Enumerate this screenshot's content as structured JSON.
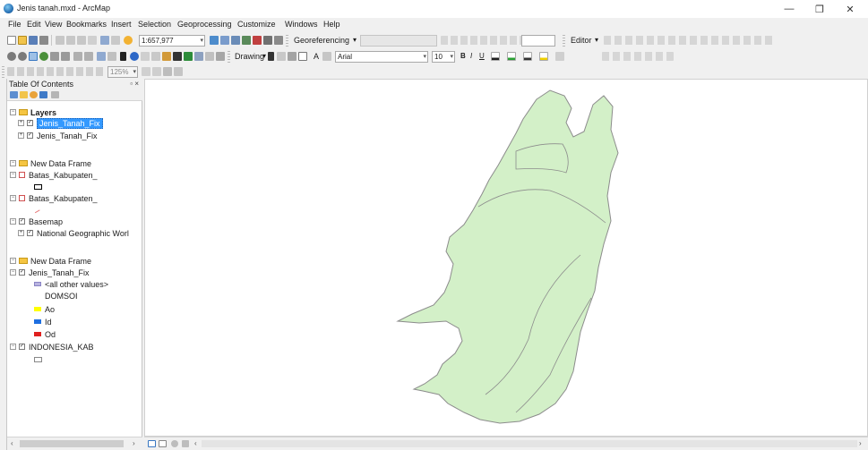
{
  "window": {
    "title": "Jenis tanah.mxd - ArcMap",
    "minimize_glyph": "—",
    "restore_glyph": "❐",
    "close_glyph": "✕"
  },
  "menu": [
    "File",
    "Edit",
    "View",
    "Bookmarks",
    "Insert",
    "Selection",
    "Geoprocessing",
    "Customize",
    "Windows",
    "Help"
  ],
  "toolbar": {
    "scale_value": "1:657,977",
    "georeferencing_label": "Georeferencing",
    "editor_label": "Editor",
    "drawing_label": "Drawing",
    "font_value": "Arial",
    "font_size_value": "10",
    "bold": "B",
    "italic": "I",
    "underline": "U",
    "text_tool": "A",
    "zoom_value": "125%"
  },
  "toc": {
    "header": "Table Of Contents",
    "pin_glyph": "▫ ×",
    "rows": [
      {
        "label": "Layers",
        "bold": true
      },
      {
        "label": "Jenis_Tanah_Fix",
        "selected": true
      },
      {
        "label": "Jenis_Tanah_Fix"
      },
      {
        "label": "New Data Frame"
      },
      {
        "label": "Batas_Kabupaten_"
      },
      {
        "label": "Batas_Kabupaten_"
      },
      {
        "label": "Basemap"
      },
      {
        "label": "National Geographic Worl"
      },
      {
        "label": "New Data Frame"
      },
      {
        "label": "Jenis_Tanah_Fix"
      },
      {
        "label": "<all other values>"
      },
      {
        "label": "DOMSOI"
      },
      {
        "label": "Ao",
        "color": "#ffff00"
      },
      {
        "label": "Id",
        "color": "#1e6fe0"
      },
      {
        "label": "Od",
        "color": "#e0201e"
      },
      {
        "label": "INDONESIA_KAB"
      }
    ]
  },
  "map": {
    "fill_color": "#d3f0c8",
    "stroke_color": "#8c8c8c"
  },
  "colors": {
    "selection": "#3399ff",
    "window_bg": "#f0f0f0"
  }
}
